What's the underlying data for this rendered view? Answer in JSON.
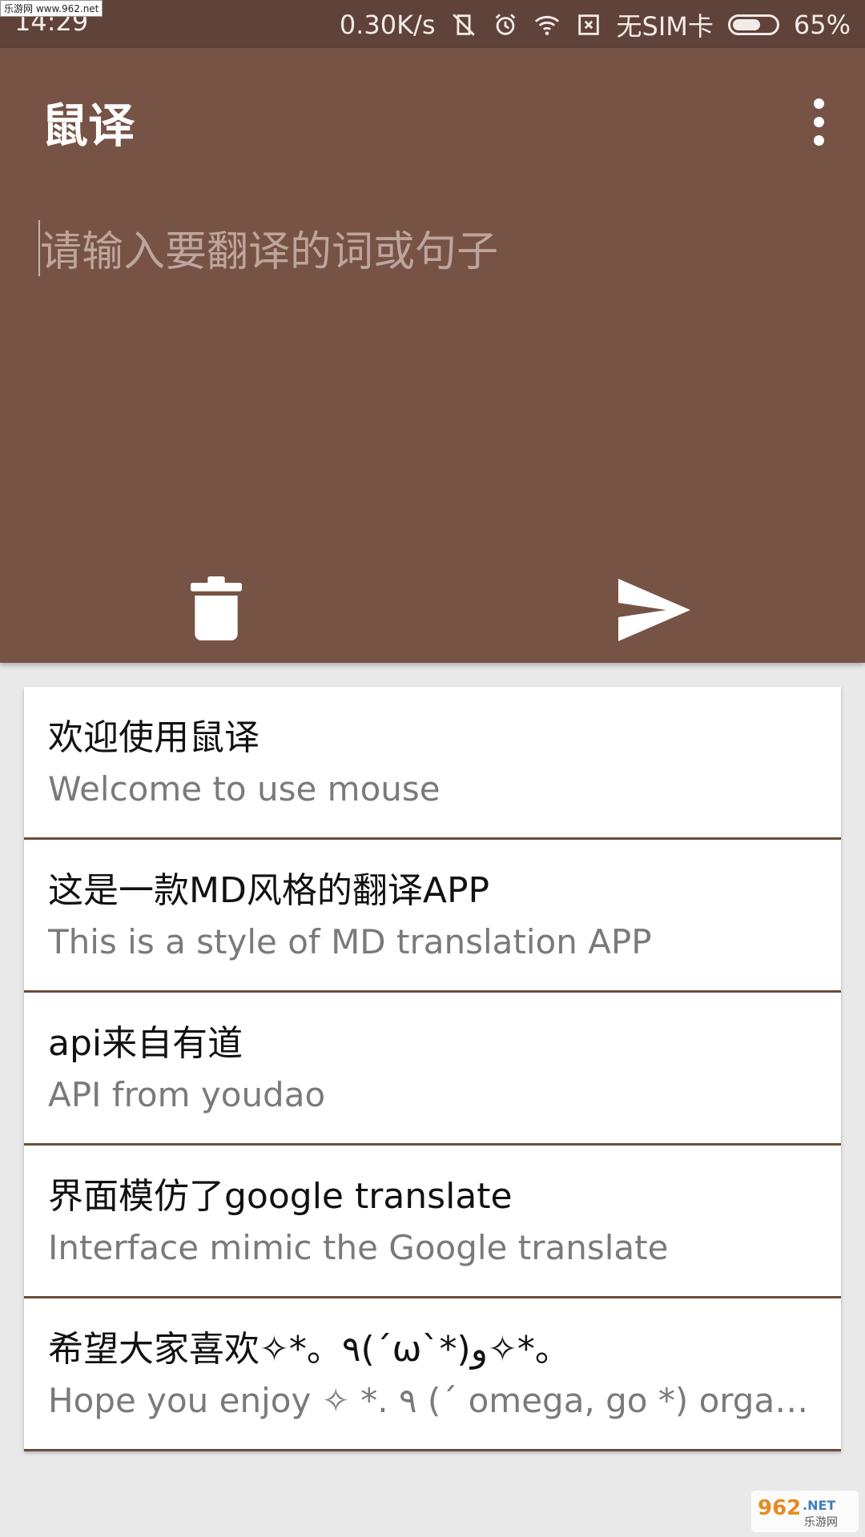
{
  "status_bar": {
    "time": "14:29",
    "speed": "0.30K/s",
    "carrier": "无SIM卡",
    "battery_percent": "65%",
    "battery_level": 0.65,
    "icons": [
      "vibrate-off-icon",
      "alarm-icon",
      "wifi-icon",
      "no-sim-icon",
      "battery-icon"
    ]
  },
  "header": {
    "title": "鼠译",
    "more_icon": "more-vert-icon"
  },
  "input": {
    "placeholder": "请输入要翻译的词或句子",
    "value": ""
  },
  "actions": {
    "delete_icon": "trash-icon",
    "send_icon": "send-icon"
  },
  "items": [
    {
      "zh": "欢迎使用鼠译",
      "en": "Welcome to use mouse"
    },
    {
      "zh": "这是一款MD风格的翻译APP",
      "en": "This is a style of MD translation APP"
    },
    {
      "zh": "api来自有道",
      "en": "API from youdao"
    },
    {
      "zh": "界面模仿了google translate",
      "en": "Interface mimic the Google translate"
    },
    {
      "zh": "希望大家喜欢✧*。٩(ˊωˋ*)و✧*。",
      "en": "Hope you enjoy ✧ *. ٩ (ˊ omega, go *) organ..."
    }
  ],
  "watermark": {
    "top_left": "乐游网 www.962.net",
    "bottom_right": "962.NET 乐游网"
  },
  "colors": {
    "header": "#775346",
    "status_bar": "#5f4239",
    "divider": "#6a4b40"
  }
}
